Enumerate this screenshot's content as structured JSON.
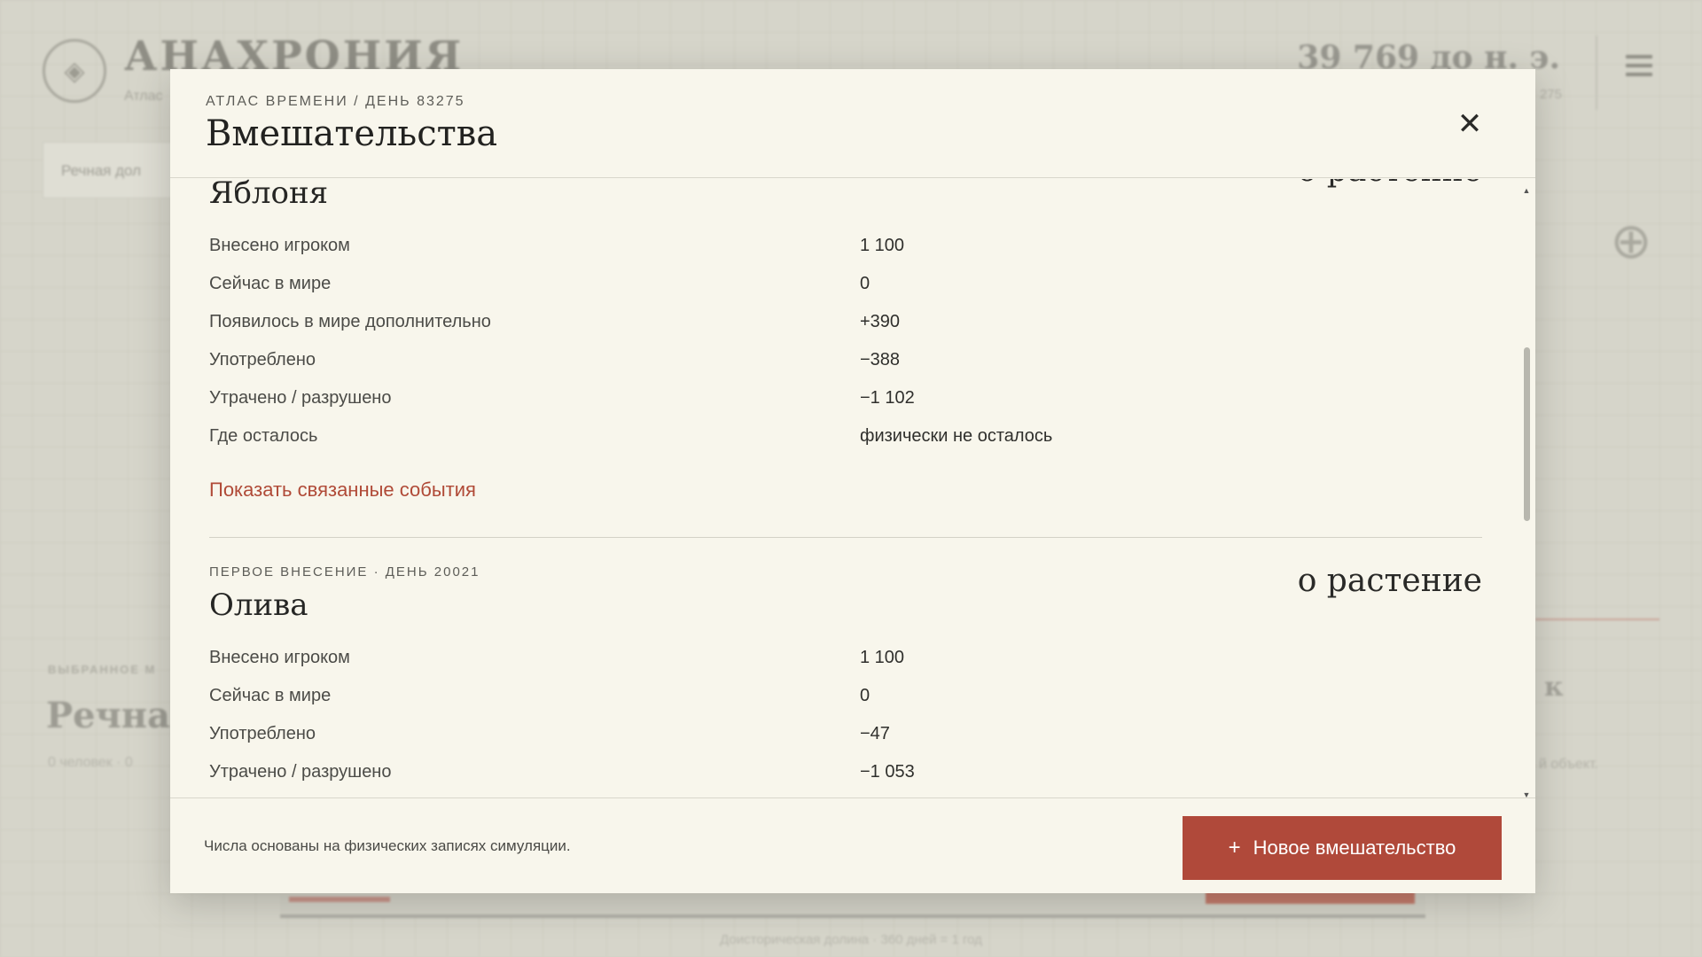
{
  "background": {
    "app_title": "АНАХРОНИЯ",
    "app_subtitle": "Атлас",
    "date": "39 769 до н. э.",
    "date_sub": "275",
    "search_text": "Речная дол",
    "selected_label": "ВЫБРАННОЕ М",
    "selected_name": "Речная",
    "selected_meta": "0 человек · 0",
    "right_letter": "к",
    "right_note": "й объект.",
    "footer_text": "Доисторическая долина · 360 дней = 1 год"
  },
  "modal": {
    "breadcrumb": "АТЛАС ВРЕМЕНИ / ДЕНЬ 83275",
    "title": "Вмешательства",
    "close_symbol": "✕",
    "sections": [
      {
        "tag": "",
        "kind": "о растение",
        "name": "Яблоня",
        "stats": [
          {
            "label": "Внесено игроком",
            "value": "1 100"
          },
          {
            "label": "Сейчас в мире",
            "value": "0"
          },
          {
            "label": "Появилось в мире дополнительно",
            "value": "+390"
          },
          {
            "label": "Употреблено",
            "value": "−388"
          },
          {
            "label": "Утрачено / разрушено",
            "value": "−1 102"
          },
          {
            "label": "Где осталось",
            "value": "физически не осталось"
          }
        ],
        "link": "Показать связанные события"
      },
      {
        "tag": "ПЕРВОЕ ВНЕСЕНИЕ · ДЕНЬ 20021",
        "kind": "о растение",
        "name": "Олива",
        "stats": [
          {
            "label": "Внесено игроком",
            "value": "1 100"
          },
          {
            "label": "Сейчас в мире",
            "value": "0"
          },
          {
            "label": "Употреблено",
            "value": "−47"
          },
          {
            "label": "Утрачено / разрушено",
            "value": "−1 053"
          }
        ]
      }
    ],
    "footer_note": "Числа основаны на физических записях симуляции.",
    "new_button": {
      "plus": "+",
      "label": "Новое вмешательство"
    }
  }
}
